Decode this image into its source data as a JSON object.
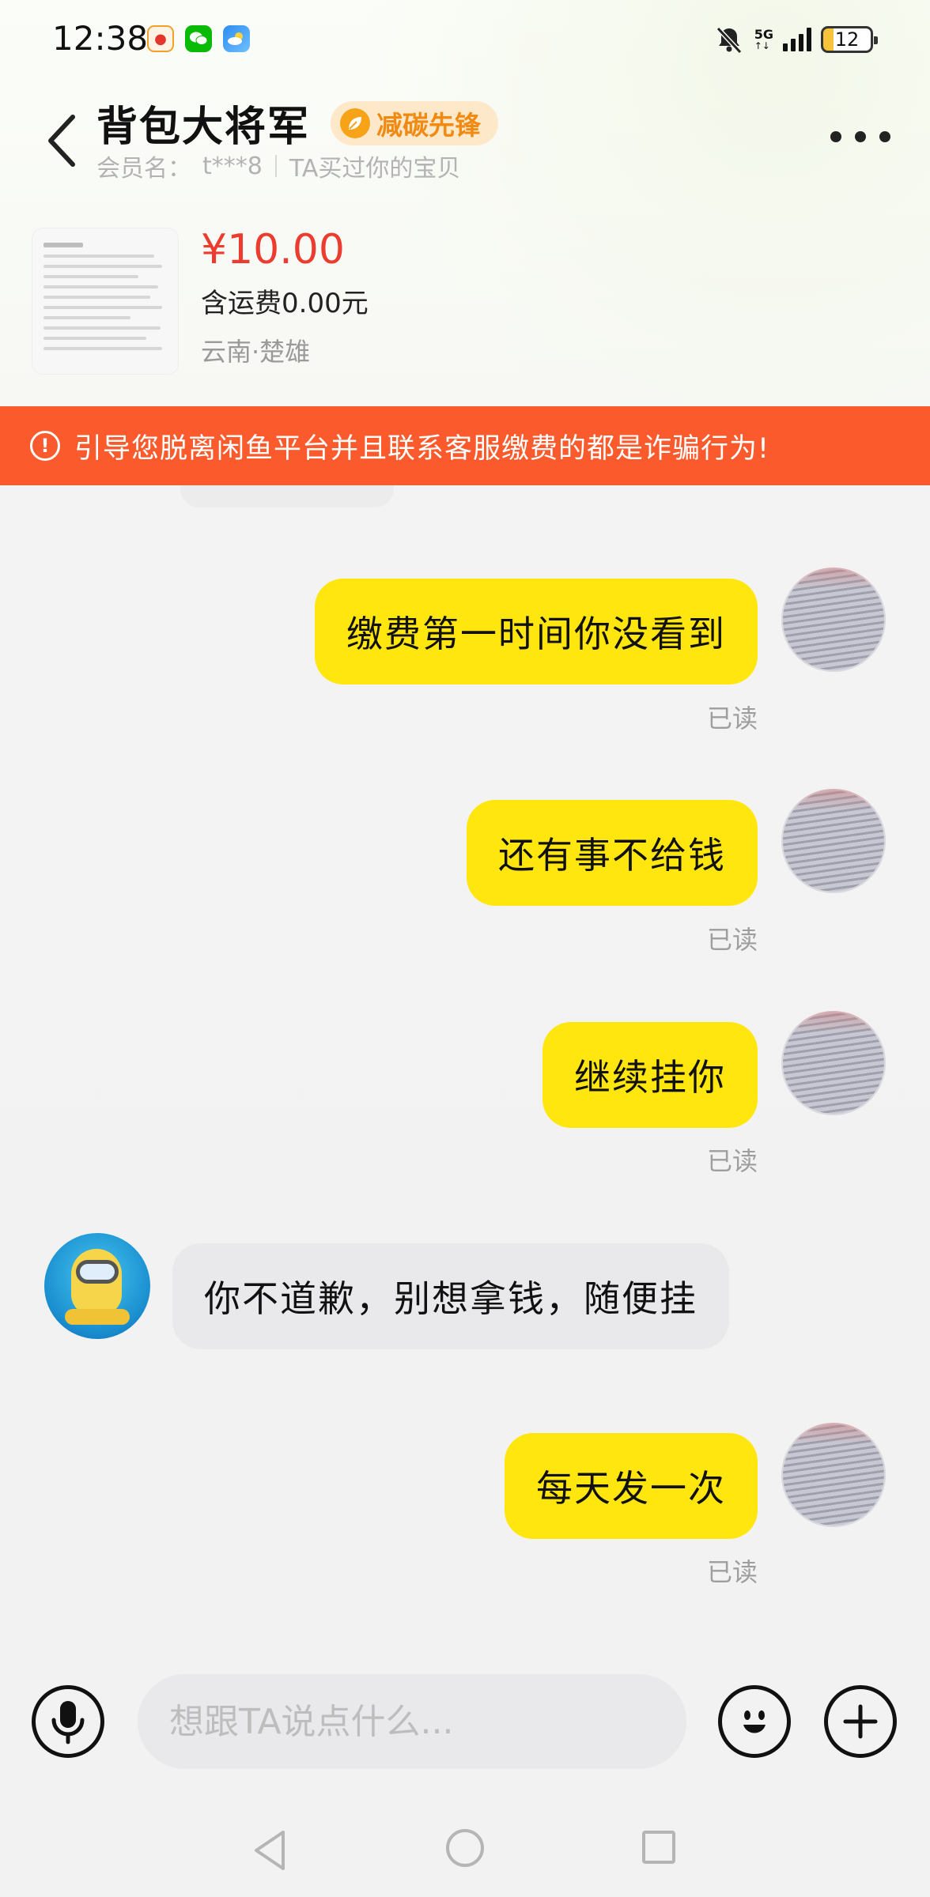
{
  "status_bar": {
    "time": "12:38",
    "app_icons": [
      "weibo-icon",
      "wechat-icon",
      "weather-icon"
    ],
    "network": "5G",
    "battery": "12"
  },
  "header": {
    "seller_name": "背包大将军",
    "badge": "减碳先锋",
    "member_label": "会员名：",
    "member_name": "t***8",
    "relation": "TA买过你的宝贝"
  },
  "product": {
    "price": "¥10.00",
    "shipping": "含运费0.00元",
    "location": "云南·楚雄"
  },
  "warning": {
    "text": "引导您脱离闲鱼平台并且联系客服缴费的都是诈骗行为!",
    "color": "#fb5a2c"
  },
  "messages": [
    {
      "side": "out",
      "text": "缴费第一时间你没看到",
      "status": "已读"
    },
    {
      "side": "out",
      "text": "还有事不给钱",
      "status": "已读"
    },
    {
      "side": "out",
      "text": "继续挂你",
      "status": "已读"
    },
    {
      "side": "in",
      "text": "你不道歉，别想拿钱，随便挂"
    },
    {
      "side": "out",
      "text": "每天发一次",
      "status": "已读"
    }
  ],
  "input": {
    "placeholder": "想跟TA说点什么..."
  },
  "colors": {
    "outgoing_bubble": "#ffe60f",
    "incoming_bubble": "#e9e9ec",
    "price": "#ec3b2f",
    "badge_text": "#f08a13"
  }
}
